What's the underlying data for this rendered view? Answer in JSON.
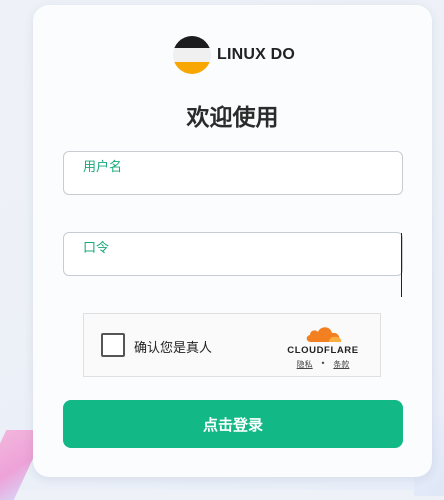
{
  "brand": {
    "name": "LINUX DO",
    "logo_colors": [
      "#1c1c1e",
      "#f0f0f0",
      "#f7a700"
    ]
  },
  "heading": "欢迎使用",
  "form": {
    "username": {
      "label": "用户名",
      "value": ""
    },
    "password": {
      "label": "口令",
      "value": ""
    }
  },
  "captcha": {
    "checkbox_label": "确认您是真人",
    "provider": "CLOUDFLARE",
    "links": {
      "privacy": "隐私",
      "terms": "条款"
    },
    "separator": "•"
  },
  "submit_label": "点击登录",
  "colors": {
    "accent": "#12b886",
    "label": "#19a87a",
    "cloudflare_orange": "#f38020"
  }
}
